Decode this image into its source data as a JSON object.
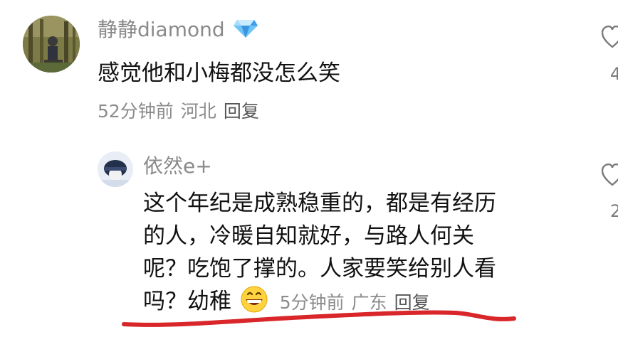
{
  "comments": [
    {
      "username": "静静diamond",
      "badge_icon": "diamond-icon",
      "text": "感觉他和小梅都没怎么笑",
      "time": "52分钟前",
      "location": "河北",
      "reply_label": "回复",
      "like_count_partial": "4"
    },
    {
      "username": "依然e+",
      "text_lines": [
        "这个年纪是成熟稳重的，都是有经历",
        "的人，冷暖自知就好，与路人何关",
        "呢？吃饱了撑的。人家要笑给别人看",
        "吗？幼稚"
      ],
      "emoji_icon": "grinning-emoji-icon",
      "time": "5分钟前",
      "location": "广东",
      "reply_label": "回复",
      "like_count_partial": "2"
    }
  ],
  "colors": {
    "username": "#8a8a8a",
    "text": "#111111",
    "meta": "#8c8c8c",
    "underline": "#d9262a",
    "diamond": "#4aa8f0"
  }
}
